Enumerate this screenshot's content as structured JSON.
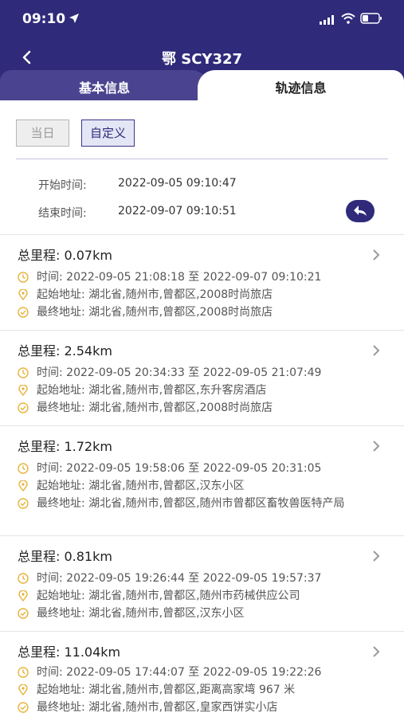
{
  "status": {
    "time": "09:10"
  },
  "nav": {
    "title": "鄂 SCY327"
  },
  "tabs": {
    "basic": "基本信息",
    "track": "轨迹信息"
  },
  "filter": {
    "today": "当日",
    "custom": "自定义"
  },
  "range": {
    "start_label": "开始时间:",
    "start_value": "2022-09-05 09:10:47",
    "end_label": "结束时间:",
    "end_value": "2022-09-07 09:10:51"
  },
  "trips": [
    {
      "title": "总里程: 0.07km",
      "time": "时间: 2022-09-05 21:08:18 至 2022-09-07 09:10:21",
      "start": "起始地址: 湖北省,随州市,曾都区,2008时尚旅店",
      "end": "最终地址: 湖北省,随州市,曾都区,2008时尚旅店"
    },
    {
      "title": "总里程: 2.54km",
      "time": "时间: 2022-09-05 20:34:33 至 2022-09-05 21:07:49",
      "start": "起始地址: 湖北省,随州市,曾都区,东升客房酒店",
      "end": "最终地址: 湖北省,随州市,曾都区,2008时尚旅店"
    },
    {
      "title": "总里程: 1.72km",
      "time": "时间: 2022-09-05 19:58:06 至 2022-09-05 20:31:05",
      "start": "起始地址: 湖北省,随州市,曾都区,汉东小区",
      "end": "最终地址: 湖北省,随州市,曾都区,随州市曾都区畜牧兽医特产局"
    },
    {
      "title": "总里程: 0.81km",
      "time": "时间: 2022-09-05 19:26:44 至 2022-09-05 19:57:37",
      "start": "起始地址: 湖北省,随州市,曾都区,随州市药械供应公司",
      "end": "最终地址: 湖北省,随州市,曾都区,汉东小区"
    },
    {
      "title": "总里程: 11.04km",
      "time": "时间: 2022-09-05 17:44:07 至 2022-09-05 19:22:26",
      "start": "起始地址: 湖北省,随州市,曾都区,距离高家塆 967 米",
      "end": "最终地址: 湖北省,随州市,曾都区,皇家西饼实小店"
    }
  ],
  "colors": {
    "brand": "#2f2a7a",
    "tab_inactive": "#4a4490",
    "accent_icon": "#e6b33a"
  },
  "icons": {
    "time": "clock-icon",
    "start": "location-pin-icon",
    "end": "check-circle-icon",
    "more": "chevron-right-icon"
  }
}
